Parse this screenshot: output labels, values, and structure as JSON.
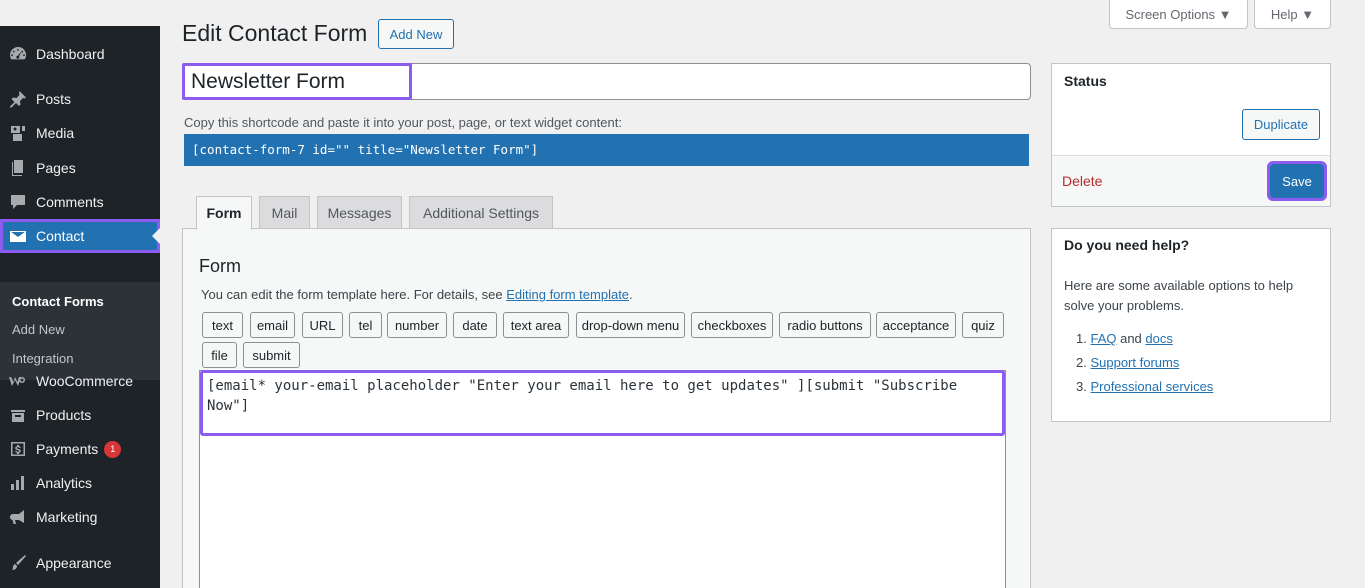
{
  "sidebar": {
    "items": [
      {
        "label": "Dashboard",
        "icon": "dashboard-icon"
      },
      {
        "label": "Posts",
        "icon": "pin-icon"
      },
      {
        "label": "Media",
        "icon": "media-icon"
      },
      {
        "label": "Pages",
        "icon": "pages-icon"
      },
      {
        "label": "Comments",
        "icon": "comment-icon"
      },
      {
        "label": "Contact",
        "icon": "envelope-icon"
      },
      {
        "label": "WooCommerce",
        "icon": "woocommerce-icon"
      },
      {
        "label": "Products",
        "icon": "products-icon"
      },
      {
        "label": "Payments",
        "icon": "payments-icon",
        "badge": "1"
      },
      {
        "label": "Analytics",
        "icon": "bar-chart-icon"
      },
      {
        "label": "Marketing",
        "icon": "megaphone-icon"
      },
      {
        "label": "Appearance",
        "icon": "brush-icon"
      }
    ],
    "submenu": [
      "Contact Forms",
      "Add New",
      "Integration"
    ]
  },
  "header": {
    "title": "Edit Contact Form",
    "add_new": "Add New",
    "screen_options": "Screen Options ▼",
    "help": "Help ▼"
  },
  "form_title": "Newsletter Form",
  "shortcode": {
    "hint": "Copy this shortcode and paste it into your post, page, or text widget content:",
    "code": "[contact-form-7 id=\"\" title=\"Newsletter Form\"]"
  },
  "tabs": [
    "Form",
    "Mail",
    "Messages",
    "Additional Settings"
  ],
  "form_panel": {
    "heading": "Form",
    "desc_prefix": "You can edit the form template here. For details, see ",
    "desc_link": "Editing form template",
    "desc_suffix": ".",
    "tag_buttons": [
      "text",
      "email",
      "URL",
      "tel",
      "number",
      "date",
      "text area",
      "drop-down menu",
      "checkboxes",
      "radio buttons",
      "acceptance",
      "quiz",
      "file",
      "submit"
    ],
    "template": "[email* your-email placeholder \"Enter your email here to get updates\" ][submit \"Subscribe Now\"]"
  },
  "status_box": {
    "title": "Status",
    "duplicate": "Duplicate",
    "delete": "Delete",
    "save": "Save"
  },
  "help_box": {
    "title": "Do you need help?",
    "text": "Here are some available options to help solve your problems.",
    "item1_num": "1.",
    "item1_a": "FAQ",
    "item1_and": " and ",
    "item1_b": "docs",
    "item2_num": "2.",
    "item2": "Support forums",
    "item3_num": "3.",
    "item3": "Professional services"
  },
  "colors": {
    "accent": "#2271b1",
    "highlight": "#8c5cf0",
    "sidebar_bg": "#1d2327",
    "delete": "#b32d2e",
    "badge": "#d63638"
  }
}
